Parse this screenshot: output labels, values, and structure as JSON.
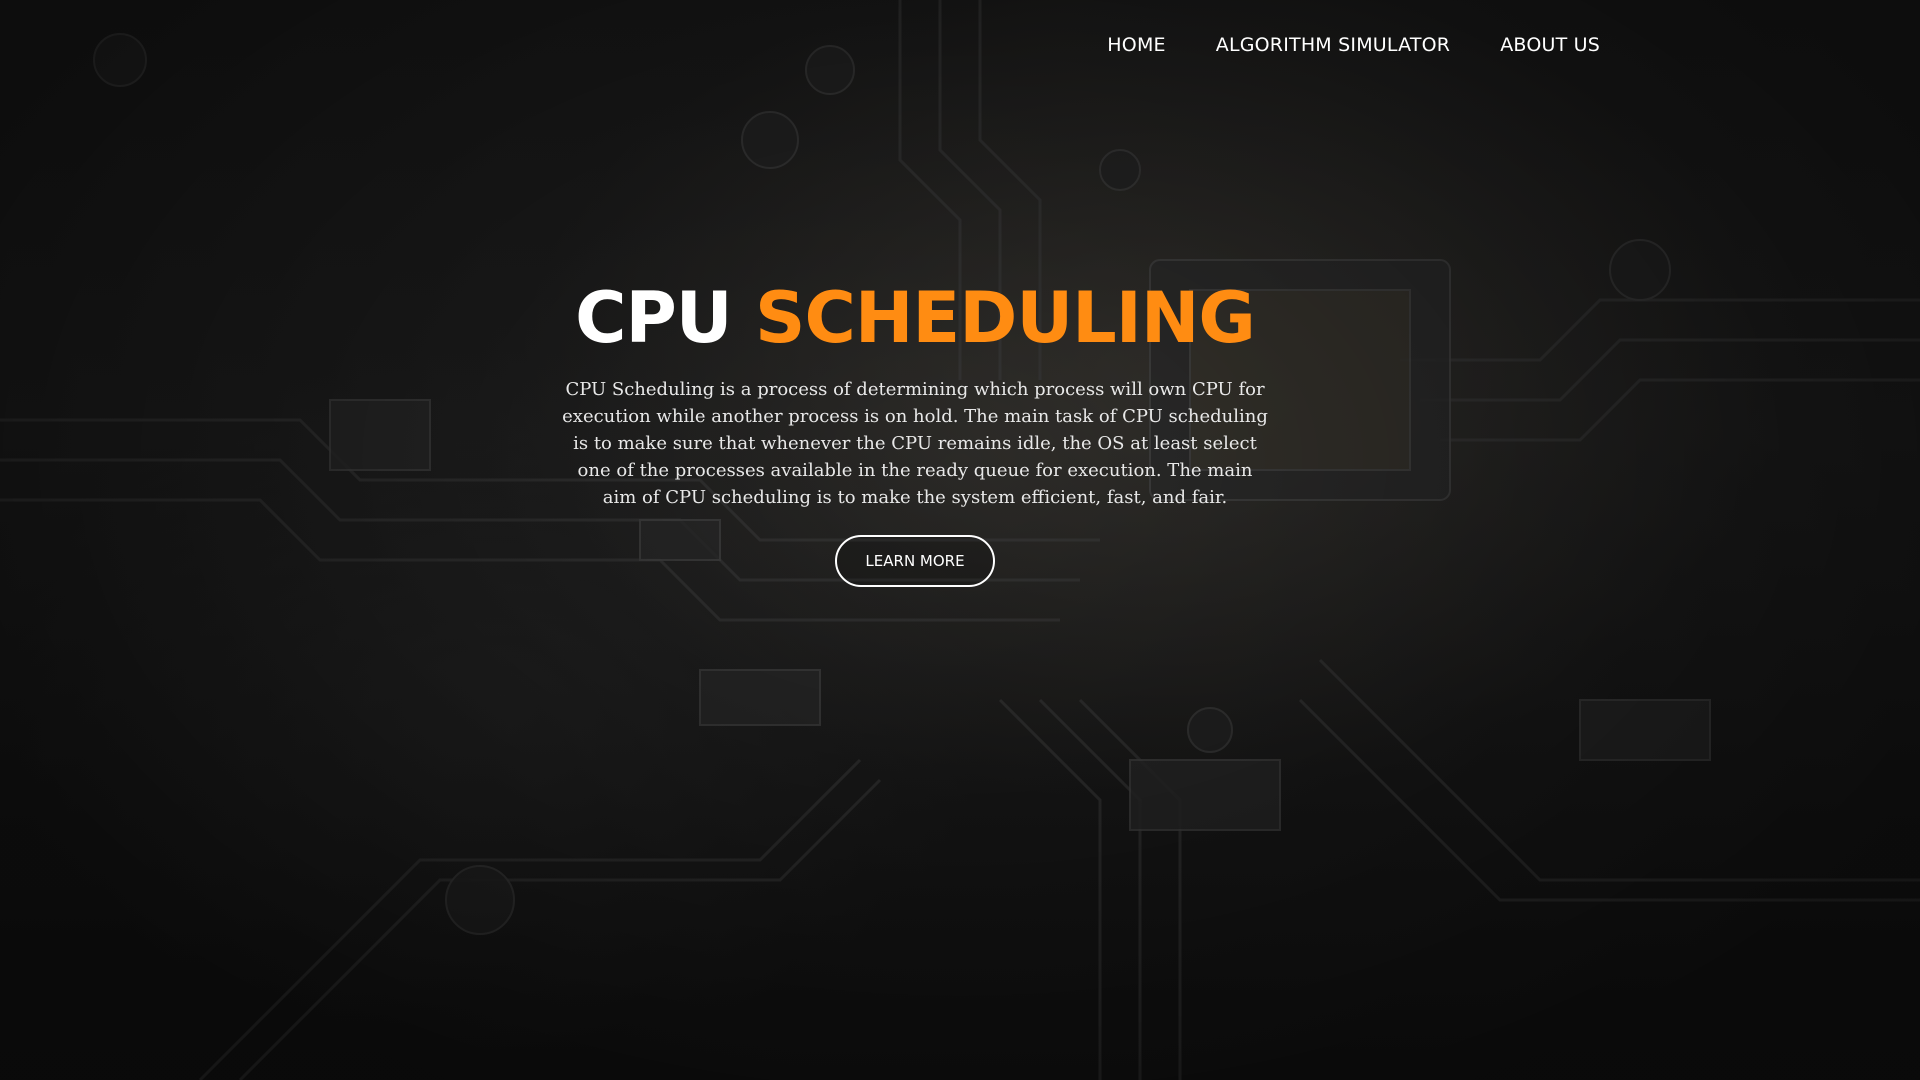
{
  "nav": {
    "items": [
      {
        "label": "HOME"
      },
      {
        "label": "ALGORITHM SIMULATOR"
      },
      {
        "label": "ABOUT US"
      }
    ]
  },
  "hero": {
    "title_part1": "CPU",
    "title_part2": "SCHEDULING",
    "description": "CPU Scheduling is a process of determining which process will own CPU for execution while another process is on hold. The main task of CPU scheduling is to make sure that whenever the CPU remains idle, the OS at least select one of the processes available in the ready queue for execution. The main aim of CPU scheduling is to make the system efficient, fast, and fair.",
    "button_label": "LEARN MORE"
  },
  "colors": {
    "accent": "#ff8c12",
    "text": "#ffffff",
    "background": "#151515"
  },
  "background": {
    "image": "circuit-board"
  }
}
